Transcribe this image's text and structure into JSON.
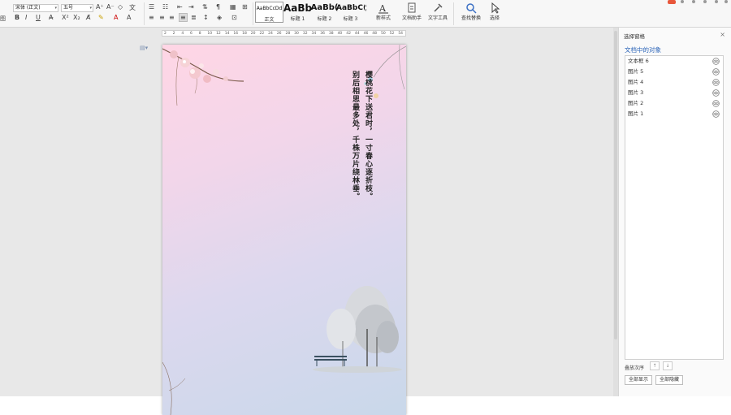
{
  "ribbon": {
    "font_name": "宋体 (正文)",
    "font_size": "五号",
    "styles": [
      {
        "preview": "AaBbCcDd",
        "name": "正文"
      },
      {
        "preview": "AaBb",
        "name": "标题 1"
      },
      {
        "preview": "AaBb(",
        "name": "标题 2"
      },
      {
        "preview": "AaBbC(",
        "name": "标题 3"
      }
    ],
    "tools": {
      "new_style": "新样式",
      "doc_helper": "文档助手",
      "text_tools": "文字工具",
      "find_replace": "查找替换",
      "select": "选择"
    },
    "left_stub": "图"
  },
  "ruler": {
    "ticks": [
      "2",
      "2",
      "4",
      "6",
      "8",
      "10",
      "12",
      "14",
      "16",
      "18",
      "20",
      "22",
      "24",
      "26",
      "28",
      "30",
      "32",
      "34",
      "36",
      "38",
      "40",
      "42",
      "44",
      "46",
      "48",
      "50",
      "52",
      "54"
    ]
  },
  "document": {
    "poem": [
      "樱桃花下送君时，一寸春心逐折枝。",
      "别后相思最多处，千株万片绕林垂。"
    ]
  },
  "panel": {
    "title": "选择窗格",
    "subtitle": "文档中的对象",
    "objects": [
      "文本框 6",
      "图片 5",
      "图片 4",
      "图片 3",
      "图片 2",
      "图片 1"
    ],
    "order_label": "叠放次序",
    "show_all": "全部显示",
    "hide_all": "全部隐藏"
  },
  "colors": {
    "accent_link": "#2a63b8",
    "page_gradient_top": "#ffd6e5",
    "page_gradient_bottom": "#c9d8ea"
  }
}
